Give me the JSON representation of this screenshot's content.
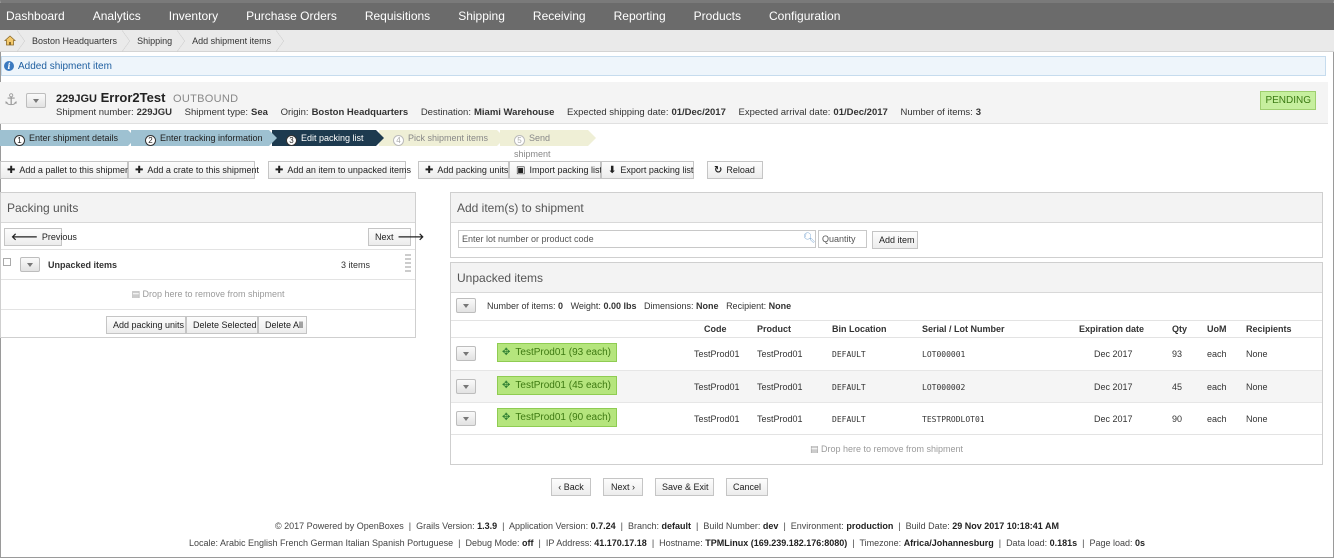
{
  "nav": [
    "Dashboard",
    "Analytics",
    "Inventory",
    "Purchase Orders",
    "Requisitions",
    "Shipping",
    "Receiving",
    "Reporting",
    "Products",
    "Configuration"
  ],
  "breadcrumb": [
    "Boston Headquarters",
    "Shipping",
    "Add shipment items"
  ],
  "message": "Added shipment item",
  "shipment": {
    "number_title": "229JGU",
    "name": "Error2Test",
    "direction": "OUTBOUND",
    "meta": {
      "number_label": "Shipment number:",
      "number": "229JGU",
      "type_label": "Shipment type:",
      "type": "Sea",
      "origin_label": "Origin:",
      "origin": "Boston Headquarters",
      "destination_label": "Destination:",
      "destination": "Miami Warehouse",
      "ship_date_label": "Expected shipping date:",
      "ship_date": "01/Dec/2017",
      "arrival_label": "Expected arrival date:",
      "arrival": "01/Dec/2017",
      "items_label": "Number of items:",
      "items": "3"
    },
    "status": "PENDING"
  },
  "wizard": [
    {
      "num": "1",
      "label": "Enter shipment details"
    },
    {
      "num": "2",
      "label": "Enter tracking information"
    },
    {
      "num": "3",
      "label": "Edit packing list"
    },
    {
      "num": "4",
      "label": "Pick shipment items"
    },
    {
      "num": "5",
      "label": "Send shipment"
    }
  ],
  "actions": {
    "add_pallet": "Add a pallet to this shipment",
    "add_crate": "Add a crate to this shipment",
    "add_item_unpacked": "Add an item to unpacked items",
    "add_packing_units": "Add packing units",
    "import_packing": "Import packing list",
    "export_packing": "Export packing list",
    "reload": "Reload"
  },
  "packing_units": {
    "title": "Packing units",
    "previous": "Previous",
    "next": "Next",
    "unpacked_label": "Unpacked items",
    "unpacked_count": "3 items",
    "drop_text": "Drop here to remove from shipment",
    "add_units": "Add packing units",
    "delete_selected": "Delete Selected",
    "delete_all": "Delete All"
  },
  "add_items": {
    "title": "Add item(s) to shipment",
    "search_placeholder": "Enter lot number or product code",
    "quantity_placeholder": "Quantity",
    "add_button": "Add item"
  },
  "unpacked": {
    "title": "Unpacked items",
    "summary": {
      "items_label": "Number of items:",
      "items": "0",
      "weight_label": "Weight:",
      "weight": "0.00 lbs",
      "dimensions_label": "Dimensions:",
      "dimensions": "None",
      "recipient_label": "Recipient:",
      "recipient": "None"
    },
    "columns": [
      "Code",
      "Product",
      "Bin Location",
      "Serial / Lot Number",
      "Expiration date",
      "Qty",
      "UoM",
      "Recipients"
    ],
    "rows": [
      {
        "tag": "TestProd01 (93 each)",
        "code": "TestProd01",
        "product": "TestProd01",
        "bin": "DEFAULT",
        "lot": "LOT000001",
        "expiry": "Dec 2017",
        "qty": "93",
        "uom": "each",
        "recipients": "None"
      },
      {
        "tag": "TestProd01 (45 each)",
        "code": "TestProd01",
        "product": "TestProd01",
        "bin": "DEFAULT",
        "lot": "LOT000002",
        "expiry": "Dec 2017",
        "qty": "45",
        "uom": "each",
        "recipients": "None"
      },
      {
        "tag": "TestProd01 (90 each)",
        "code": "TestProd01",
        "product": "TestProd01",
        "bin": "DEFAULT",
        "lot": "TESTPRODLOT01",
        "expiry": "Dec 2017",
        "qty": "90",
        "uom": "each",
        "recipients": "None"
      }
    ],
    "drop_text": "Drop here to remove from shipment"
  },
  "bottom_buttons": {
    "back": "‹ Back",
    "next": "Next ›",
    "save_exit": "Save & Exit",
    "cancel": "Cancel"
  },
  "footer": {
    "line1": {
      "powered": "© 2017 Powered by OpenBoxes",
      "grails_label": "Grails Version:",
      "grails": "1.3.9",
      "app_label": "Application Version:",
      "app": "0.7.24",
      "branch_label": "Branch:",
      "branch": "default",
      "build_label": "Build Number:",
      "build": "dev",
      "env_label": "Environment:",
      "env": "production",
      "date_label": "Build Date:",
      "date": "29 Nov 2017 10:18:41 AM"
    },
    "line2": {
      "locale_label": "Locale:",
      "locales": "Arabic English French German Italian Spanish Portuguese",
      "debug_label": "Debug Mode:",
      "debug": "off",
      "ip_label": "IP Address:",
      "ip": "41.170.17.18",
      "host_label": "Hostname:",
      "host": "TPMLinux (169.239.182.176:8080)",
      "tz_label": "Timezone:",
      "tz": "Africa/Johannesburg",
      "dataload_label": "Data load:",
      "dataload": "0.181s",
      "pageload_label": "Page load:",
      "pageload": "0s"
    }
  }
}
